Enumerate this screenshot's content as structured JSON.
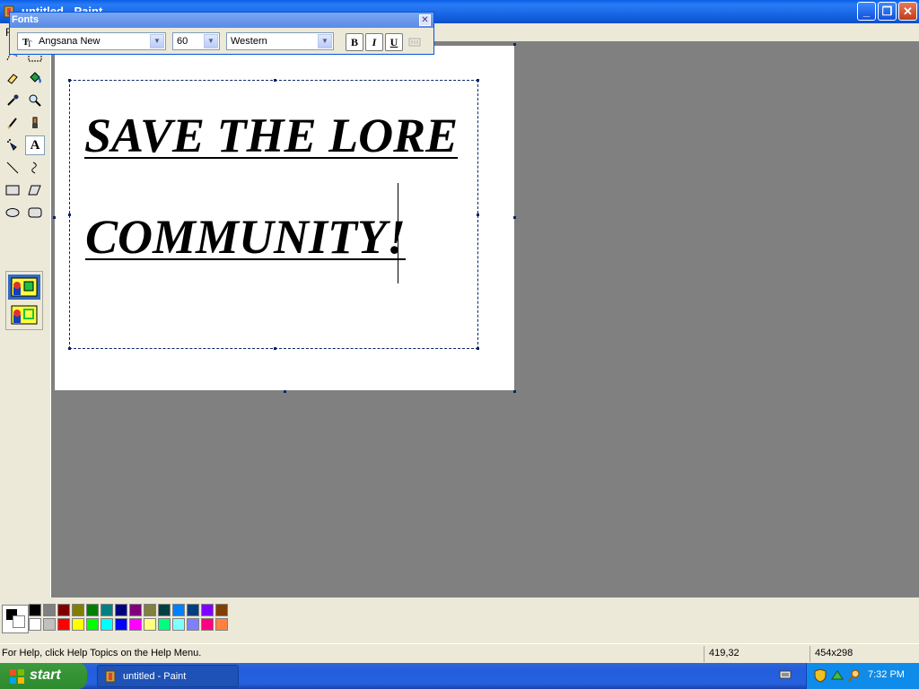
{
  "window": {
    "title": "untitled - Paint"
  },
  "menubar": {
    "first_letter": "F"
  },
  "fonts_toolbar": {
    "title": "Fonts",
    "font_name": "Angsana New",
    "font_size": "60",
    "script": "Western",
    "bold": "B",
    "italic": "I",
    "underline": "U"
  },
  "canvas": {
    "line1": "SAVE THE LORE ",
    "line2": "COMMUNITY!"
  },
  "palette": {
    "top_row": [
      "#000000",
      "#808080",
      "#800000",
      "#808000",
      "#008000",
      "#008080",
      "#000080",
      "#800080",
      "#808040",
      "#004040",
      "#0080ff",
      "#004080",
      "#8000ff",
      "#804000"
    ],
    "bottom_row": [
      "#ffffff",
      "#c0c0c0",
      "#ff0000",
      "#ffff00",
      "#00ff00",
      "#00ffff",
      "#0000ff",
      "#ff00ff",
      "#ffff80",
      "#00ff80",
      "#80ffff",
      "#8080ff",
      "#ff0080",
      "#ff8040"
    ]
  },
  "status": {
    "help": "For Help, click Help Topics on the Help Menu.",
    "coords": "419,32",
    "size": "454x298"
  },
  "taskbar": {
    "start": "start",
    "task": "untitled - Paint",
    "clock": "7:32 PM"
  }
}
